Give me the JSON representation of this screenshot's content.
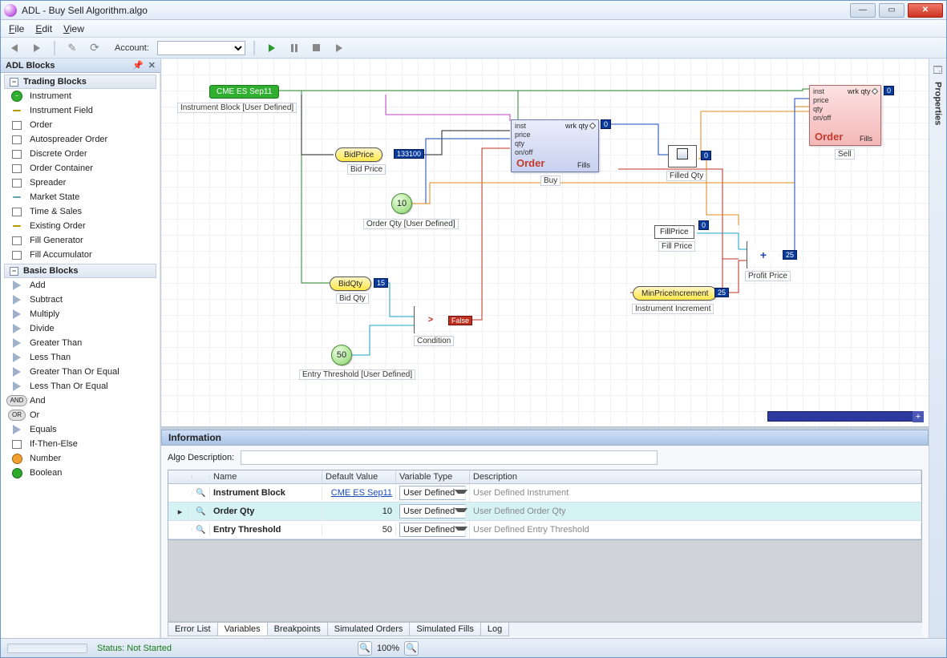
{
  "window": {
    "title": "ADL - Buy Sell Algorithm.algo"
  },
  "menu": {
    "file": "File",
    "edit": "Edit",
    "view": "View"
  },
  "toolbar": {
    "account_label": "Account:"
  },
  "sidebar": {
    "title": "ADL Blocks",
    "group1": "Trading Blocks",
    "group2": "Basic Blocks",
    "trading_items": [
      "Instrument",
      "Instrument Field",
      "Order",
      "Autospreader Order",
      "Discrete Order",
      "Order Container",
      "Spreader",
      "Market State",
      "Time & Sales",
      "Existing Order",
      "Fill Generator",
      "Fill Accumulator"
    ],
    "basic_items": [
      "Add",
      "Subtract",
      "Multiply",
      "Divide",
      "Greater Than",
      "Less Than",
      "Greater Than Or Equal",
      "Less Than Or Equal",
      "And",
      "Or",
      "Equals",
      "If-Then-Else",
      "Number",
      "Boolean"
    ]
  },
  "properties": {
    "label": "Properties"
  },
  "canvas": {
    "instrument": "CME ES Sep11",
    "instrument_caption": "Instrument Block [User Defined]",
    "bidprice": {
      "label": "BidPrice",
      "caption": "Bid Price",
      "value": "133100"
    },
    "bidqty": {
      "label": "BidQty",
      "caption": "Bid Qty",
      "value": "15"
    },
    "orderqty": {
      "value": "10",
      "caption": "Order Qty [User Defined]"
    },
    "entrythreshold": {
      "value": "50",
      "caption": "Entry Threshold [User Defined]"
    },
    "condition": {
      "caption": "Condition",
      "symbol": ">",
      "output": "False"
    },
    "orderbuy": {
      "title": "Order",
      "inputs": "inst\nprice\nqty\non/off",
      "wrk": "wrk qty",
      "wrkval": "0",
      "fills": "Fills",
      "caption": "Buy"
    },
    "ordersell": {
      "title": "Order",
      "inputs": "inst\nprice\nqty\non/off",
      "wrk": "wrk qty",
      "wrkval": "0",
      "fills": "Fills",
      "caption": "Sell"
    },
    "filledqty": {
      "caption": "Filled Qty",
      "value": "0"
    },
    "fillprice": {
      "label": "FillPrice",
      "caption": "Fill Price",
      "value": "0"
    },
    "minpriceinc": {
      "label": "MinPriceIncrement",
      "caption": "Instrument Increment",
      "value": "25"
    },
    "profitprice": {
      "symbol": "+",
      "caption": "Profit Price",
      "value": "25"
    }
  },
  "info": {
    "panel_title": "Information",
    "algo_desc_label": "Algo Description:",
    "headers": {
      "name": "Name",
      "default": "Default Value",
      "vtype": "Variable Type",
      "desc": "Description"
    },
    "rows": [
      {
        "name": "Instrument Block",
        "default": "CME ES Sep11",
        "vtype": "User Defined",
        "desc": "User Defined Instrument",
        "link": true
      },
      {
        "name": "Order Qty",
        "default": "10",
        "vtype": "User Defined",
        "desc": "User Defined Order Qty",
        "selected": true
      },
      {
        "name": "Entry Threshold",
        "default": "50",
        "vtype": "User Defined",
        "desc": "User Defined Entry Threshold"
      }
    ],
    "tabs": [
      "Error List",
      "Variables",
      "Breakpoints",
      "Simulated Orders",
      "Simulated Fills",
      "Log"
    ],
    "active_tab": "Variables"
  },
  "status": {
    "text": "Status: Not Started",
    "zoom": "100%"
  }
}
